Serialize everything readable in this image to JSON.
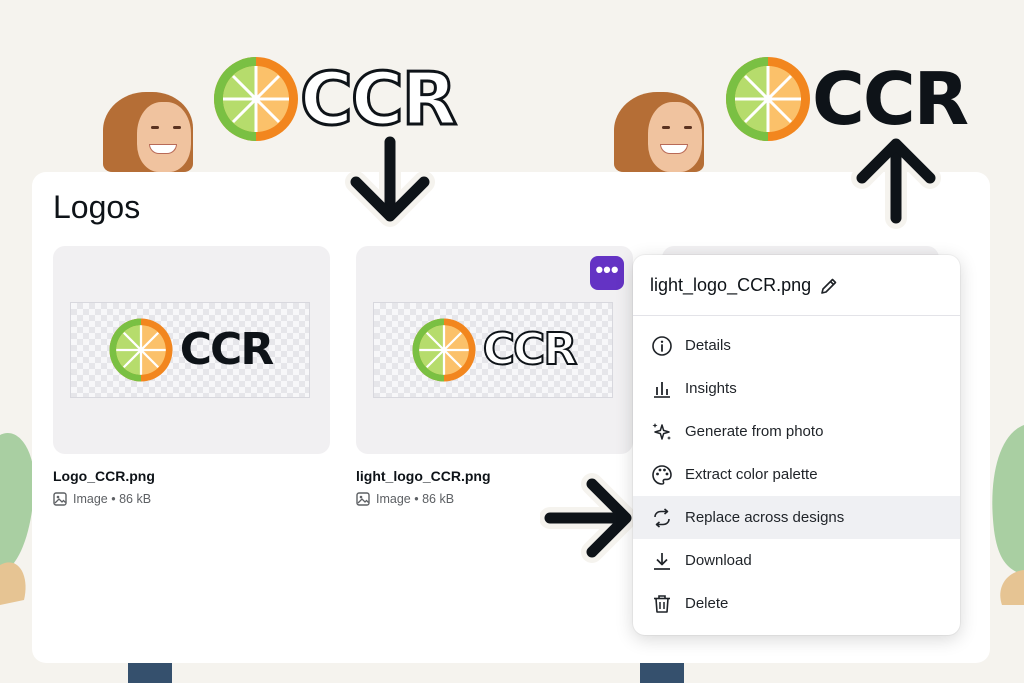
{
  "brand_text": "CCR",
  "colors": {
    "accent": "#6433c4",
    "orange": "#f2861e",
    "green": "#7ac043",
    "ink": "#0e1318"
  },
  "card": {
    "title": "Logos"
  },
  "assets": [
    {
      "name": "Logo_CCR.png",
      "meta": "Image • 86 kB",
      "icon": "image-icon"
    },
    {
      "name": "light_logo_CCR.png",
      "meta": "Image • 86 kB",
      "icon": "image-icon"
    }
  ],
  "more_button": {
    "label": "•••",
    "icon": "more-horizontal-icon"
  },
  "menu": {
    "title": "light_logo_CCR.png",
    "title_icon": "pencil-icon",
    "items": [
      {
        "label": "Details",
        "icon": "info-icon"
      },
      {
        "label": "Insights",
        "icon": "bar-chart-icon"
      },
      {
        "label": "Generate from photo",
        "icon": "sparkle-icon"
      },
      {
        "label": "Extract color palette",
        "icon": "palette-icon"
      },
      {
        "label": "Replace across designs",
        "icon": "replace-icon",
        "highlighted": true
      },
      {
        "label": "Download",
        "icon": "download-icon"
      },
      {
        "label": "Delete",
        "icon": "trash-icon"
      }
    ]
  }
}
